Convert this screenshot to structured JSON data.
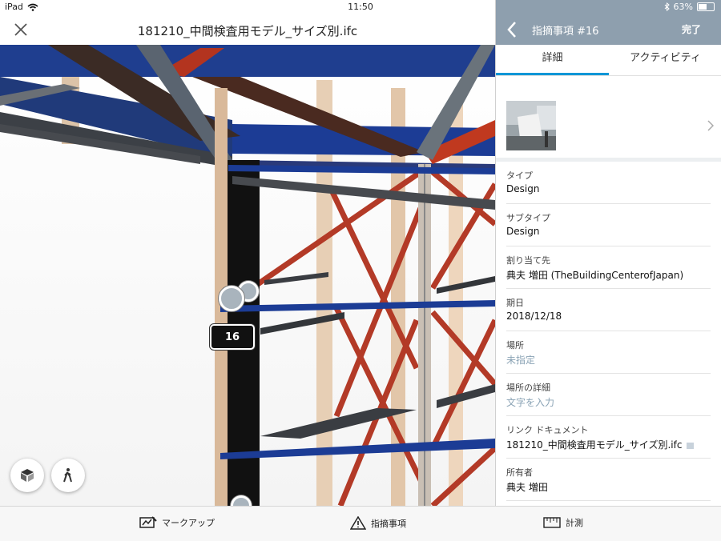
{
  "status": {
    "device": "iPad",
    "time": "11:50",
    "battery": "63%",
    "battery_level": 0.63
  },
  "viewer": {
    "file_title": "181210_中間検査用モデル_サイズ別.ifc",
    "issue_tag": "16",
    "icons": {
      "close": "close-icon",
      "model_browser": "cube-icon",
      "walk": "walk-icon"
    }
  },
  "panel": {
    "back_icon": "chevron-left-icon",
    "title": "指摘事項 #16",
    "done": "完了",
    "tabs": [
      {
        "label": "詳細",
        "active": true
      },
      {
        "label": "アクティビティ",
        "active": false
      }
    ],
    "fields": [
      {
        "label": "タイプ",
        "value": "Design"
      },
      {
        "label": "サブタイプ",
        "value": "Design"
      },
      {
        "label": "割り当て先",
        "value": "典夫 増田 (TheBuildingCenterofJapan)"
      },
      {
        "label": "期日",
        "value": "2018/12/18"
      },
      {
        "label": "場所",
        "value": "未指定",
        "placeholder": true
      },
      {
        "label": "場所の詳細",
        "value": "文字を入力",
        "placeholder": true
      },
      {
        "label": "リンク ドキュメント",
        "value": "181210_中間検査用モデル_サイズ別.ifc"
      },
      {
        "label": "所有者",
        "value": "典夫 増田"
      }
    ]
  },
  "bottom": {
    "markup": "マークアップ",
    "issues": "指摘事項",
    "measure": "計測"
  },
  "colors": {
    "panel_header": "#8e9fae",
    "accent": "#0696d7",
    "placeholder": "#8aa3b5"
  }
}
